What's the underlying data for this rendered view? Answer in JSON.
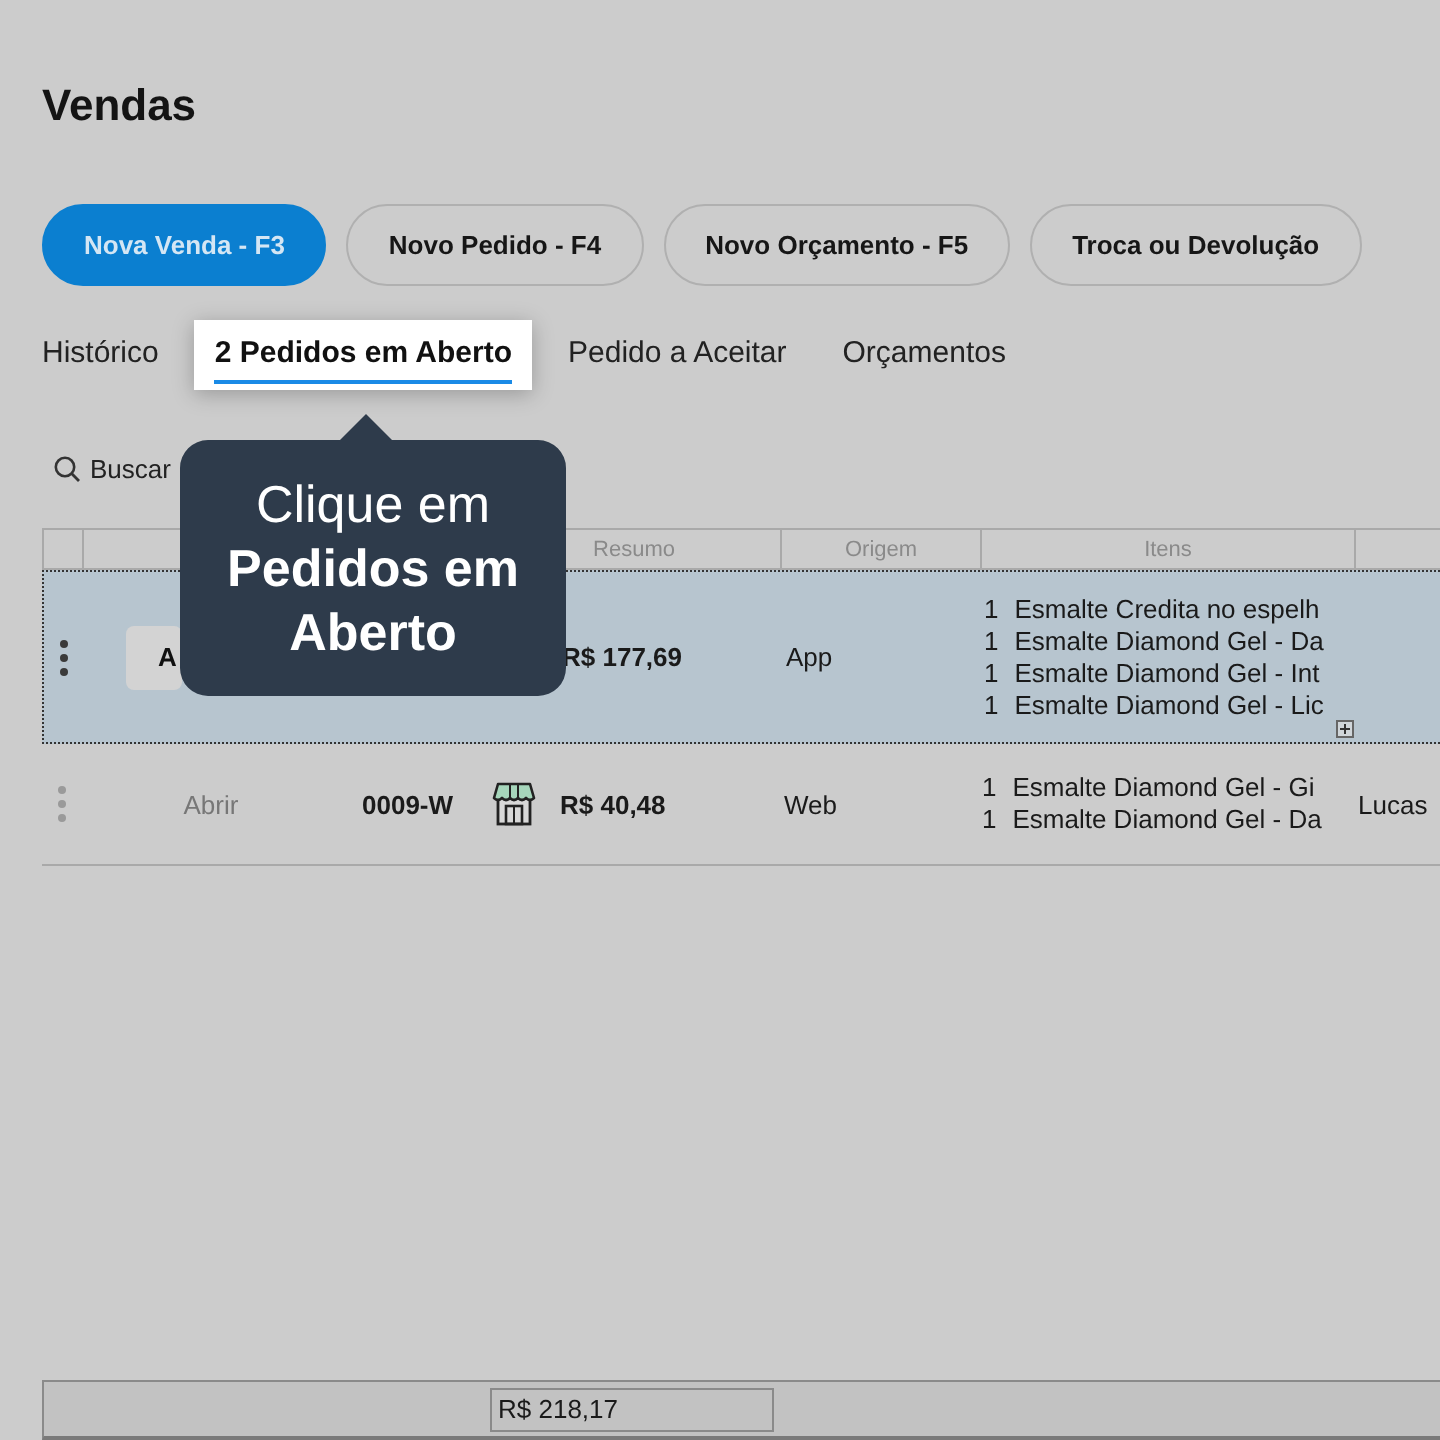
{
  "page": {
    "title": "Vendas"
  },
  "actions": [
    {
      "label": "Nova Venda - F3",
      "primary": true
    },
    {
      "label": "Novo Pedido - F4",
      "primary": false
    },
    {
      "label": "Novo Orçamento - F5",
      "primary": false
    },
    {
      "label": "Troca ou Devolução",
      "primary": false
    }
  ],
  "tabs": [
    {
      "label": "Histórico",
      "selected": false
    },
    {
      "label": "2 Pedidos em Aberto",
      "selected": true
    },
    {
      "label": "Pedido a Aceitar",
      "selected": false
    },
    {
      "label": "Orçamentos",
      "selected": false
    }
  ],
  "search": {
    "label": "Buscar"
  },
  "table": {
    "columns": [
      {
        "label": "Resumo"
      },
      {
        "label": "Origem"
      },
      {
        "label": "Itens"
      }
    ],
    "rows": [
      {
        "selected": true,
        "action": "A",
        "total": "R$ 177,69",
        "origin": "App",
        "items": [
          {
            "qty": "1",
            "name": "Esmalte Credita no espelh"
          },
          {
            "qty": "1",
            "name": "Esmalte Diamond Gel - Da"
          },
          {
            "qty": "1",
            "name": "Esmalte Diamond Gel - Int"
          },
          {
            "qty": "1",
            "name": "Esmalte Diamond Gel - Lic"
          }
        ],
        "expandable": true
      },
      {
        "selected": false,
        "action": "Abrir",
        "order": "0009-W",
        "total": "R$ 40,48",
        "origin": "Web",
        "items": [
          {
            "qty": "1",
            "name": "Esmalte Diamond Gel - Gi"
          },
          {
            "qty": "1",
            "name": "Esmalte Diamond Gel - Da"
          }
        ],
        "expandable": false,
        "column_7": "Lucas"
      }
    ]
  },
  "footer": {
    "total": "R$ 218,17"
  },
  "tooltip": {
    "text": "Clique em **Pedidos em Aberto**"
  }
}
